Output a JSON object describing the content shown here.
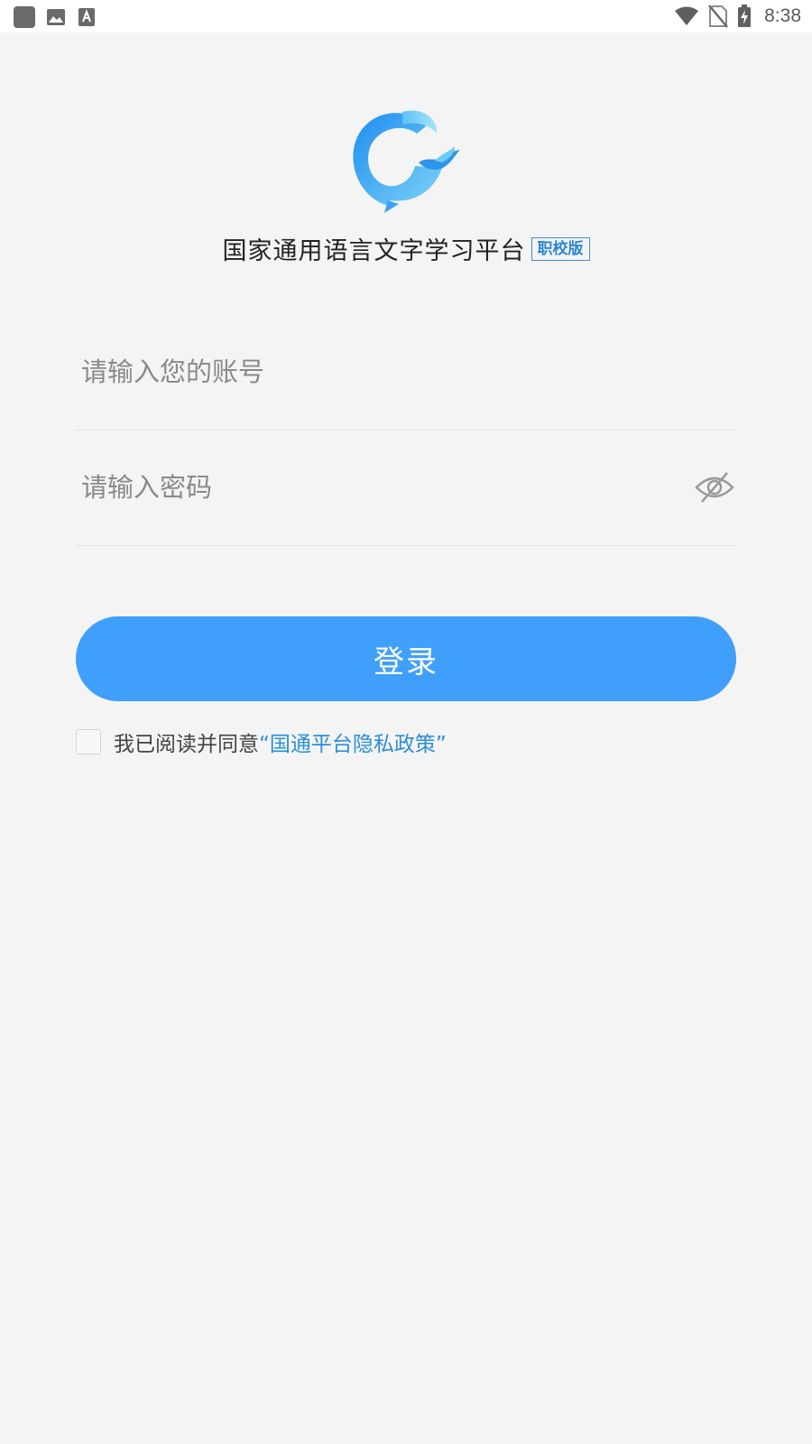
{
  "status_bar": {
    "time": "8:38",
    "left_icons": [
      "app-notification-icon",
      "image-notification-icon",
      "text-notification-icon"
    ],
    "right_icons": [
      "wifi-icon",
      "no-sim-icon",
      "battery-charging-icon"
    ]
  },
  "app": {
    "title": "国家通用语言文字学习平台",
    "edition_badge": "职校版",
    "logo": "whale-g-logo",
    "brand_color": "#409ffb"
  },
  "form": {
    "account_placeholder": "请输入您的账号",
    "account_value": "",
    "password_placeholder": "请输入密码",
    "password_value": "",
    "password_visibility_icon": "eye-slash-icon",
    "login_label": "登录"
  },
  "agreement": {
    "checked": false,
    "text": "我已阅读并同意",
    "policy_link": "“国通平台隐私政策”",
    "link_color": "#2a8fd8"
  }
}
